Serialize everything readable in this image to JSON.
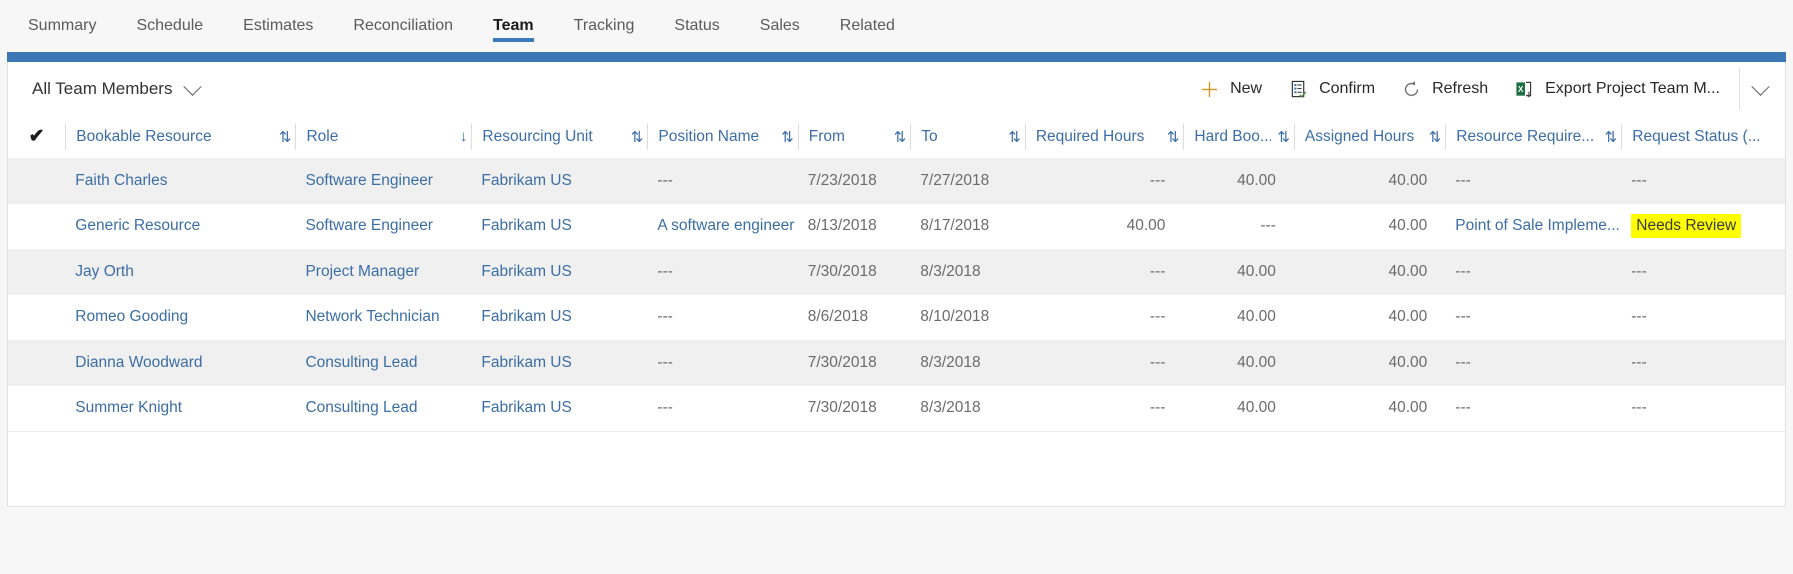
{
  "tabs": [
    {
      "label": "Summary",
      "active": false
    },
    {
      "label": "Schedule",
      "active": false
    },
    {
      "label": "Estimates",
      "active": false
    },
    {
      "label": "Reconciliation",
      "active": false
    },
    {
      "label": "Team",
      "active": true
    },
    {
      "label": "Tracking",
      "active": false
    },
    {
      "label": "Status",
      "active": false
    },
    {
      "label": "Sales",
      "active": false
    },
    {
      "label": "Related",
      "active": false
    }
  ],
  "commandbar": {
    "view_selector_label": "All Team Members",
    "view_selector_icon": "chevron-down-icon",
    "new_label": "New",
    "new_icon": "plus-icon",
    "confirm_label": "Confirm",
    "confirm_icon": "clipboard-check-icon",
    "refresh_label": "Refresh",
    "refresh_icon": "refresh-icon",
    "export_label": "Export Project Team M...",
    "export_icon": "excel-export-icon",
    "overflow_icon": "chevron-down-icon"
  },
  "grid": {
    "select_all_icon": "checkmark-icon",
    "columns": [
      {
        "label": "Bookable Resource",
        "sort": "both"
      },
      {
        "label": "Role",
        "sort": "desc"
      },
      {
        "label": "Resourcing Unit",
        "sort": "both"
      },
      {
        "label": "Position Name",
        "sort": "both"
      },
      {
        "label": "From",
        "sort": "both"
      },
      {
        "label": "To",
        "sort": "both"
      },
      {
        "label": "Required Hours",
        "sort": "both"
      },
      {
        "label": "Hard Boo...",
        "sort": "both"
      },
      {
        "label": "Assigned Hours",
        "sort": "both"
      },
      {
        "label": "Resource Require...",
        "sort": "both"
      },
      {
        "label": "Request Status (...",
        "sort": "none"
      }
    ],
    "rows": [
      {
        "bookable_resource": "Faith Charles",
        "role": "Software Engineer",
        "resourcing_unit": "Fabrikam US",
        "position_name": "---",
        "from": "7/23/2018",
        "to": "7/27/2018",
        "required_hours": "---",
        "hard_booked": "40.00",
        "assigned_hours": "40.00",
        "resource_requirement": "---",
        "request_status": "---",
        "request_status_highlighted": false
      },
      {
        "bookable_resource": "Generic Resource",
        "role": "Software Engineer",
        "resourcing_unit": "Fabrikam US",
        "position_name": "A software engineer",
        "from": "8/13/2018",
        "to": "8/17/2018",
        "required_hours": "40.00",
        "hard_booked": "---",
        "assigned_hours": "40.00",
        "resource_requirement": "Point of Sale Impleme...",
        "request_status": "Needs Review",
        "request_status_highlighted": true
      },
      {
        "bookable_resource": "Jay Orth",
        "role": "Project Manager",
        "resourcing_unit": "Fabrikam US",
        "position_name": "---",
        "from": "7/30/2018",
        "to": "8/3/2018",
        "required_hours": "---",
        "hard_booked": "40.00",
        "assigned_hours": "40.00",
        "resource_requirement": "---",
        "request_status": "---",
        "request_status_highlighted": false
      },
      {
        "bookable_resource": "Romeo Gooding",
        "role": "Network Technician",
        "resourcing_unit": "Fabrikam US",
        "position_name": "---",
        "from": "8/6/2018",
        "to": "8/10/2018",
        "required_hours": "---",
        "hard_booked": "40.00",
        "assigned_hours": "40.00",
        "resource_requirement": "---",
        "request_status": "---",
        "request_status_highlighted": false
      },
      {
        "bookable_resource": "Dianna Woodward",
        "role": "Consulting Lead",
        "resourcing_unit": "Fabrikam US",
        "position_name": "---",
        "from": "7/30/2018",
        "to": "8/3/2018",
        "required_hours": "---",
        "hard_booked": "40.00",
        "assigned_hours": "40.00",
        "resource_requirement": "---",
        "request_status": "---",
        "request_status_highlighted": false
      },
      {
        "bookable_resource": "Summer Knight",
        "role": "Consulting Lead",
        "resourcing_unit": "Fabrikam US",
        "position_name": "---",
        "from": "7/30/2018",
        "to": "8/3/2018",
        "required_hours": "---",
        "hard_booked": "40.00",
        "assigned_hours": "40.00",
        "resource_requirement": "---",
        "request_status": "---",
        "request_status_highlighted": false
      }
    ]
  },
  "colors": {
    "accent": "#3b78b5",
    "link": "#3c6ea5",
    "highlight": "#ffff00",
    "alt_row": "#f0f0f0",
    "page_bg": "#f7f7f7"
  }
}
